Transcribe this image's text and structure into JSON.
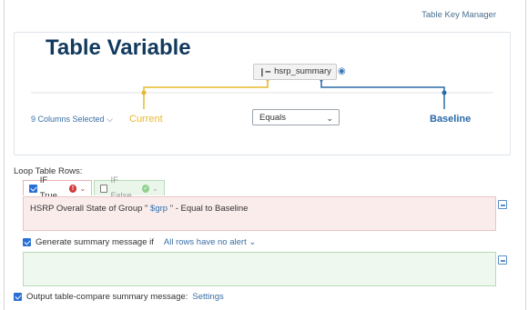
{
  "header": {
    "table_key_manager": "Table Key Manager"
  },
  "panel": {
    "title": "Table Variable",
    "variable_name": "hsrp_summary",
    "columns_selected": "9 Columns Selected",
    "current_label": "Current",
    "baseline_label": "Baseline",
    "operator": {
      "selected": "Equals"
    }
  },
  "loop": {
    "label": "Loop Table Rows:",
    "tab_true": "IF True",
    "tab_false": "IF False",
    "condition_prefix": "HSRP Overall State of Group \"",
    "condition_var": "$grp",
    "condition_suffix": "\" - Equal to Baseline",
    "generate_label": "Generate summary message if",
    "generate_option": "All rows have no alert",
    "output_label": "Output table-compare summary message:",
    "settings_link": "Settings"
  },
  "colors": {
    "current": "#e8b92a",
    "baseline": "#2a6aa8",
    "title": "#123a5e",
    "true_tab_bg": "#fbecec",
    "false_tab_bg": "#eaf6ea"
  },
  "icons": [
    "table-icon",
    "eye-icon",
    "chevron-down-icon",
    "error-icon",
    "check-circle-icon",
    "edit-icon"
  ]
}
